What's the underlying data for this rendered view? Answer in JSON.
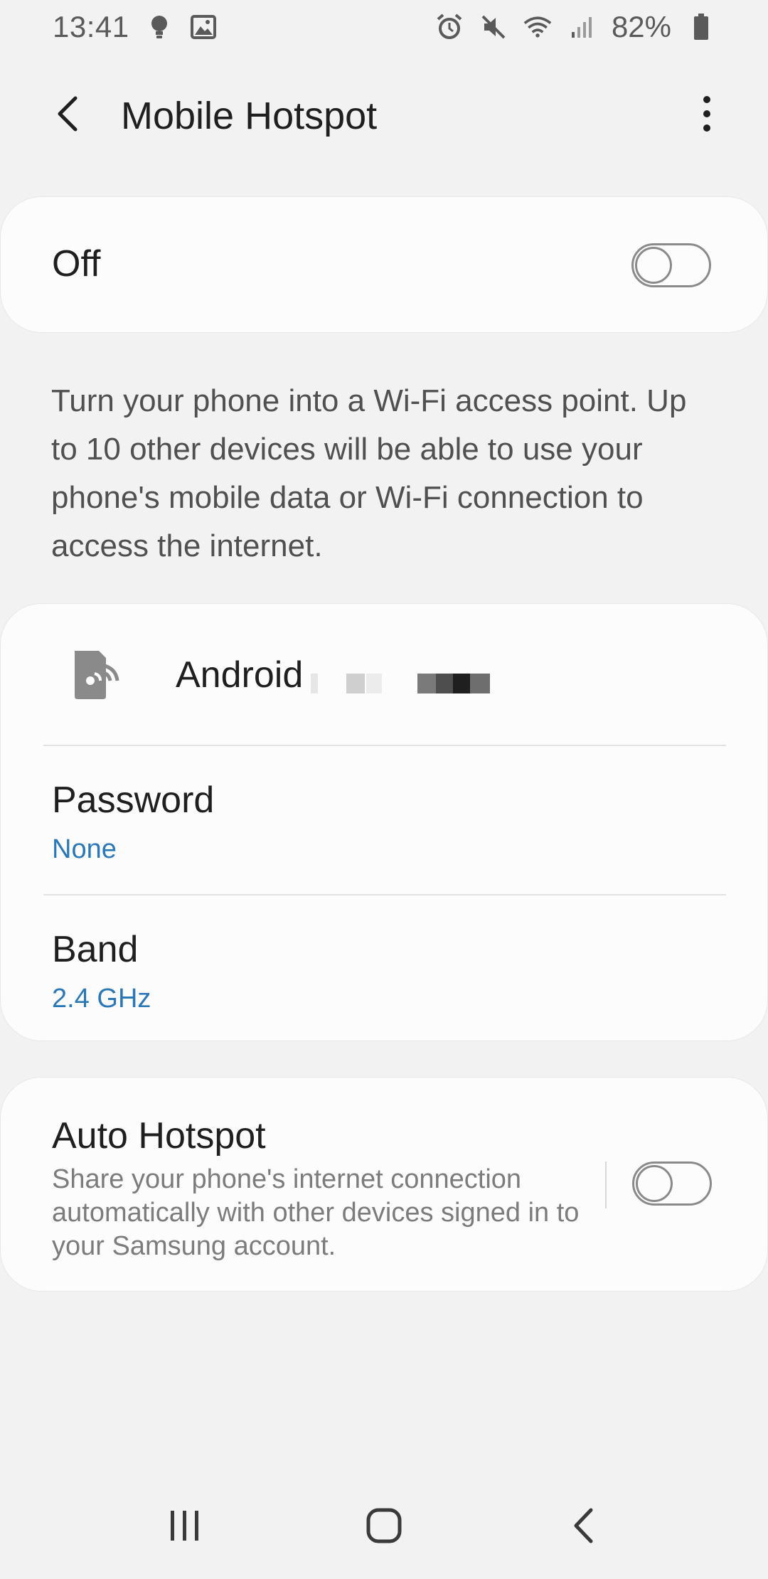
{
  "status_bar": {
    "time": "13:41",
    "battery": "82%",
    "icons": [
      "bulb-icon",
      "image-icon",
      "alarm-icon",
      "mute-icon",
      "wifi-icon",
      "signal-icon",
      "battery-icon"
    ]
  },
  "app_bar": {
    "title": "Mobile Hotspot",
    "back_icon": "back-arrow-icon",
    "more_icon": "more-vert-icon"
  },
  "main_toggle": {
    "label": "Off",
    "state": false
  },
  "description": "Turn your phone into a Wi-Fi access point. Up to 10 other devices will be able to use your phone's mobile data or Wi-Fi connection to access the internet.",
  "network": {
    "icon": "hotspot-icon",
    "name": "Android"
  },
  "password": {
    "label": "Password",
    "value": "None"
  },
  "band": {
    "label": "Band",
    "value": "2.4 GHz"
  },
  "auto_hotspot": {
    "title": "Auto Hotspot",
    "description": "Share your phone's internet connection automatically with other devices signed in to your Samsung account.",
    "state": false
  },
  "nav_bar": {
    "recents_icon": "recents-icon",
    "home_icon": "home-icon",
    "back_icon": "nav-back-icon"
  },
  "colors": {
    "accent": "#2a78b8",
    "background": "#f2f2f2",
    "card": "#fcfcfc"
  }
}
